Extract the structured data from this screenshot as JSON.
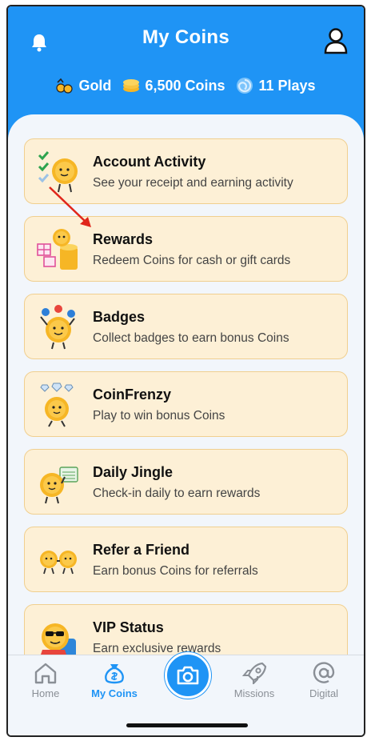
{
  "header": {
    "title": "My Coins",
    "stats": [
      {
        "label": "Gold"
      },
      {
        "label": "6,500 Coins"
      },
      {
        "label": "11 Plays"
      }
    ]
  },
  "menu": [
    {
      "title": "Account Activity",
      "subtitle": "See your receipt and earning activity",
      "icon": "coin-checklist-icon"
    },
    {
      "title": "Rewards",
      "subtitle": "Redeem Coins for cash or gift cards",
      "icon": "coin-gifts-icon"
    },
    {
      "title": "Badges",
      "subtitle": "Collect badges to earn bonus Coins",
      "icon": "coin-badges-icon"
    },
    {
      "title": "CoinFrenzy",
      "subtitle": "Play to win bonus Coins",
      "icon": "coin-diamonds-icon"
    },
    {
      "title": "Daily Jingle",
      "subtitle": "Check-in daily to earn rewards",
      "icon": "coin-calendar-icon"
    },
    {
      "title": "Refer a Friend",
      "subtitle": "Earn bonus Coins for referrals",
      "icon": "coin-friends-icon"
    },
    {
      "title": "VIP Status",
      "subtitle": "Earn exclusive rewards",
      "icon": "coin-vip-icon"
    }
  ],
  "tabs": [
    {
      "label": "Home"
    },
    {
      "label": "My Coins"
    },
    {
      "label": "Missions"
    },
    {
      "label": "Digital"
    }
  ],
  "colors": {
    "brand": "#1f94f5",
    "card_bg": "#fdf0d6",
    "card_border": "#f0cf8f",
    "annotation_arrow": "#e0261b"
  }
}
